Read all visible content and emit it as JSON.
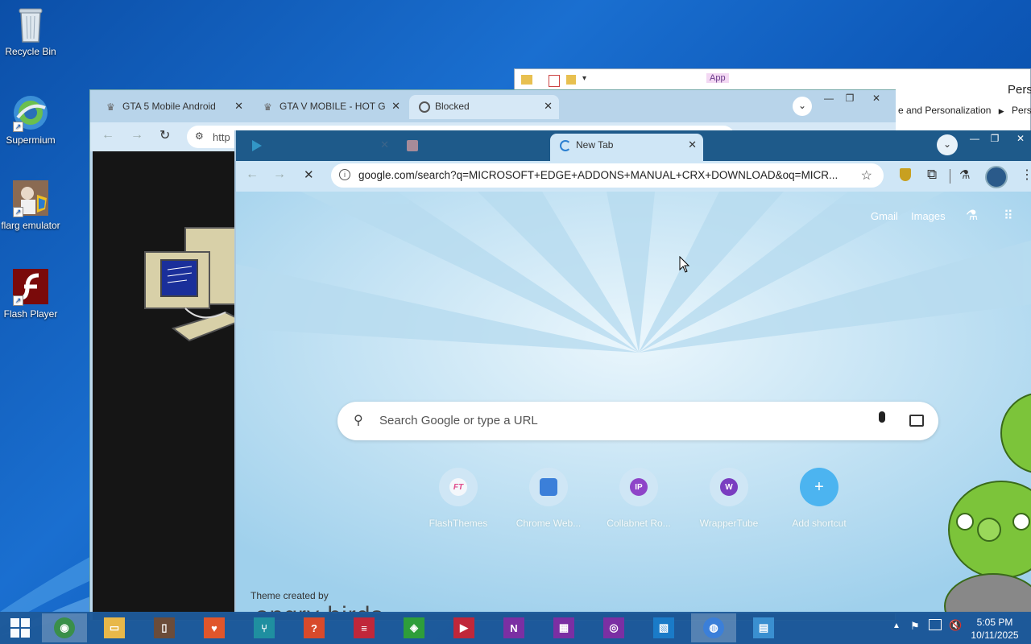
{
  "desktop": {
    "icons": [
      {
        "label": "Recycle Bin",
        "icon": "recycle-bin-icon"
      },
      {
        "label": "Supermium",
        "icon": "supermium-icon"
      },
      {
        "label": "flarg emulator",
        "icon": "flarg-emulator-icon"
      },
      {
        "label": "Flash Player",
        "icon": "flash-player-icon"
      }
    ]
  },
  "explorer_window": {
    "app_label": "App",
    "title_partial": "Perso",
    "breadcrumb": [
      "e and Personalization",
      "Perso"
    ]
  },
  "back_browser": {
    "tabs": [
      {
        "label": "GTA 5 Mobile Android"
      },
      {
        "label": "GTA V MOBILE - HOT G"
      },
      {
        "label": "Blocked"
      }
    ],
    "url_partial": "http"
  },
  "front_browser": {
    "tabs": [
      {
        "label": "New Tab",
        "active": true
      }
    ],
    "url": "google.com/search?q=MICROSOFT+EDGE+ADDONS+MANUAL+CRX+DOWNLOAD&oq=MICR...",
    "header_links": {
      "gmail": "Gmail",
      "images": "Images"
    },
    "search_placeholder": "Search Google or type a URL",
    "shortcuts": [
      {
        "label": "FlashThemes",
        "badge": "FT",
        "color": "#e8f0f6"
      },
      {
        "label": "Chrome Web...",
        "badge": "",
        "color": "#3b7fd9"
      },
      {
        "label": "Collabnet Ro...",
        "badge": "IP",
        "color": "#8e44c8"
      },
      {
        "label": "WrapperTube",
        "badge": "W",
        "color": "#7a3dc0"
      },
      {
        "label": "Add shortcut",
        "badge": "+",
        "color": "#4cb4f0"
      }
    ],
    "theme_credit": "Theme created by",
    "theme_author": "angry birds"
  },
  "taskbar": {
    "time": "5:05 PM",
    "date": "10/11/2025",
    "apps": [
      {
        "icon": "supermium-icon",
        "color": "#3a8f4a"
      },
      {
        "icon": "file-explorer-icon",
        "color": "#e8b84a"
      },
      {
        "icon": "photo-app-icon",
        "color": "#6b4c3a"
      },
      {
        "icon": "health-icon",
        "color": "#e0562b"
      },
      {
        "icon": "food-icon",
        "color": "#1f8fa0"
      },
      {
        "icon": "help-icon",
        "color": "#d84a2b"
      },
      {
        "icon": "news-icon",
        "color": "#c0273a"
      },
      {
        "icon": "xbox-icon",
        "color": "#2e9e3a"
      },
      {
        "icon": "video-icon",
        "color": "#c0273a"
      },
      {
        "icon": "onenote-icon",
        "color": "#7b2fa3"
      },
      {
        "icon": "maps-icon",
        "color": "#7b2fa3"
      },
      {
        "icon": "camera-icon",
        "color": "#7b2fa3"
      },
      {
        "icon": "photos-icon",
        "color": "#1a7bc8"
      },
      {
        "icon": "chrome-icon",
        "color": "#3b7fd9"
      },
      {
        "icon": "control-panel-icon",
        "color": "#3a8fd0"
      }
    ]
  }
}
